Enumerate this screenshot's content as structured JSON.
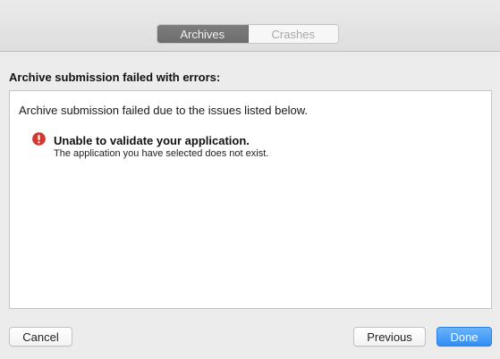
{
  "tabs": [
    {
      "label": "Archives",
      "active": true
    },
    {
      "label": "Crashes",
      "active": false
    }
  ],
  "heading": "Archive submission failed with errors:",
  "panel": {
    "intro": "Archive submission failed due to the issues listed below.",
    "issues": [
      {
        "icon": "error-icon",
        "title": "Unable to validate your application.",
        "detail": "The application you have selected does not exist."
      }
    ]
  },
  "buttons": {
    "cancel": "Cancel",
    "previous": "Previous",
    "done": "Done"
  },
  "colors": {
    "accent": "#2f8ff6",
    "error": "#d9352b",
    "active_segment": "#727272"
  }
}
